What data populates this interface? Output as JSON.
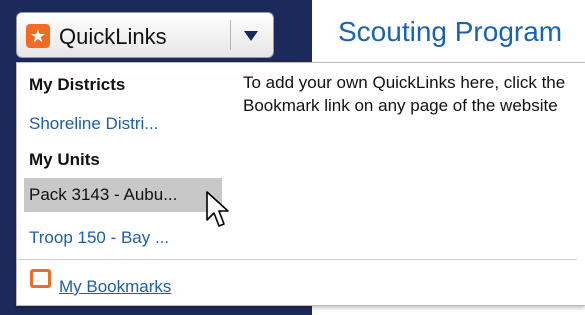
{
  "page": {
    "title": "Scouting Program"
  },
  "quicklinks_button": {
    "label": "QuickLinks",
    "star_icon": "star-icon",
    "caret_icon": "caret-down-icon",
    "accent": "#f26b22"
  },
  "dropdown": {
    "districts_heading": "My Districts",
    "districts": [
      {
        "label": "Shoreline Distri..."
      }
    ],
    "units_heading": "My Units",
    "units": [
      {
        "label": "Pack 3143 - Aubu...",
        "highlighted": true
      },
      {
        "label": "Troop 150 - Bay ..."
      }
    ],
    "help_text": "To add your own QuickLinks here, click the Bookmark link on any page of the website",
    "bookmarks_link": "My Bookmarks",
    "bookmarks_icon": "folder-icon"
  },
  "colors": {
    "link": "#1b5fa8",
    "title": "#1a63b3",
    "navy": "#1b2a5a",
    "highlight": "#c8c8c8"
  }
}
